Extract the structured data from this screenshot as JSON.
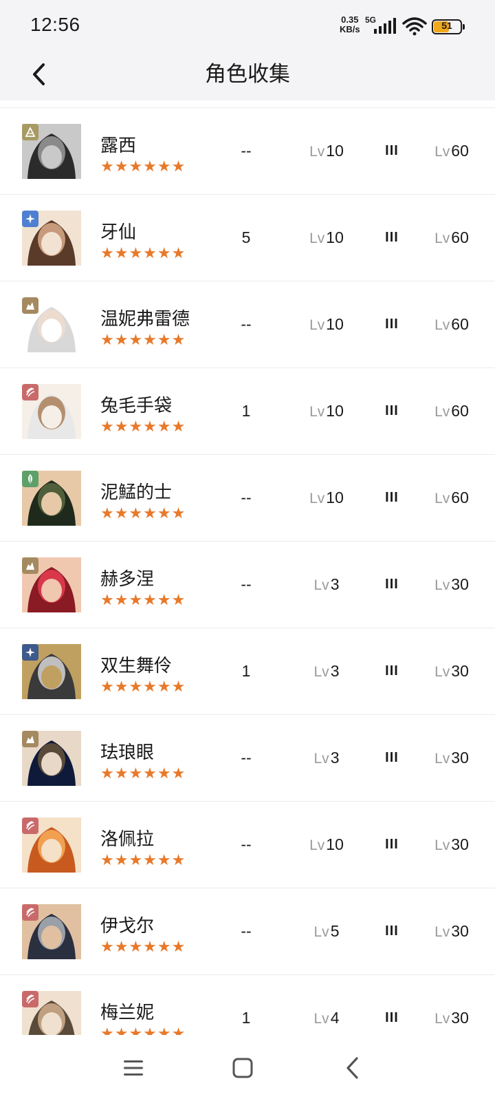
{
  "status_bar": {
    "time": "12:56",
    "net_speed_value": "0.35",
    "net_speed_unit": "KB/s",
    "network": "5G",
    "battery": "51",
    "battery_color": "#f0a81c"
  },
  "header": {
    "title": "角色收集"
  },
  "colors": {
    "star": "#e8792a",
    "divider": "#ececec"
  },
  "characters": [
    {
      "name": "露西",
      "stars": "★★★★★★",
      "element_icon": "triangle-icon",
      "element_color": "#a79a62",
      "count": "--",
      "lv_prefix": "Lv",
      "level": "10",
      "rank": "III",
      "max_prefix": "Lv",
      "max_level": "60"
    },
    {
      "name": "牙仙",
      "stars": "★★★★★★",
      "element_icon": "star-cross-icon",
      "element_color": "#4f7fd0",
      "count": "5",
      "lv_prefix": "Lv",
      "level": "10",
      "rank": "III",
      "max_prefix": "Lv",
      "max_level": "60"
    },
    {
      "name": "温妮弗雷德",
      "stars": "★★★★★★",
      "element_icon": "rock-icon",
      "element_color": "#a58960",
      "count": "--",
      "lv_prefix": "Lv",
      "level": "10",
      "rank": "III",
      "max_prefix": "Lv",
      "max_level": "60"
    },
    {
      "name": "兔毛手袋",
      "stars": "★★★★★★",
      "element_icon": "flame-icon",
      "element_color": "#c96a6a",
      "count": "1",
      "lv_prefix": "Lv",
      "level": "10",
      "rank": "III",
      "max_prefix": "Lv",
      "max_level": "60"
    },
    {
      "name": "泥鯭的士",
      "stars": "★★★★★★",
      "element_icon": "leaf-icon",
      "element_color": "#5fa06a",
      "count": "--",
      "lv_prefix": "Lv",
      "level": "10",
      "rank": "III",
      "max_prefix": "Lv",
      "max_level": "60"
    },
    {
      "name": "赫多涅",
      "stars": "★★★★★★",
      "element_icon": "rock-icon",
      "element_color": "#a58960",
      "count": "--",
      "lv_prefix": "Lv",
      "level": "3",
      "rank": "III",
      "max_prefix": "Lv",
      "max_level": "30"
    },
    {
      "name": "双生舞伶",
      "stars": "★★★★★★",
      "element_icon": "star-cross-icon",
      "element_color": "#3d5a8c",
      "count": "1",
      "lv_prefix": "Lv",
      "level": "3",
      "rank": "III",
      "max_prefix": "Lv",
      "max_level": "30"
    },
    {
      "name": "珐琅眼",
      "stars": "★★★★★★",
      "element_icon": "rock-icon",
      "element_color": "#a58960",
      "count": "--",
      "lv_prefix": "Lv",
      "level": "3",
      "rank": "III",
      "max_prefix": "Lv",
      "max_level": "30"
    },
    {
      "name": "洛佩拉",
      "stars": "★★★★★★",
      "element_icon": "flame-icon",
      "element_color": "#c96a6a",
      "count": "--",
      "lv_prefix": "Lv",
      "level": "10",
      "rank": "III",
      "max_prefix": "Lv",
      "max_level": "30"
    },
    {
      "name": "伊戈尔",
      "stars": "★★★★★★",
      "element_icon": "flame-icon",
      "element_color": "#c96a6a",
      "count": "--",
      "lv_prefix": "Lv",
      "level": "5",
      "rank": "III",
      "max_prefix": "Lv",
      "max_level": "30"
    },
    {
      "name": "梅兰妮",
      "stars": "★★★★★★",
      "element_icon": "flame-icon",
      "element_color": "#c96a6a",
      "count": "1",
      "lv_prefix": "Lv",
      "level": "4",
      "rank": "III",
      "max_prefix": "Lv",
      "max_level": "30"
    }
  ],
  "nav": {
    "menu_icon": "menu-icon",
    "home_icon": "square-home-icon",
    "back_icon": "triangle-back-icon"
  }
}
